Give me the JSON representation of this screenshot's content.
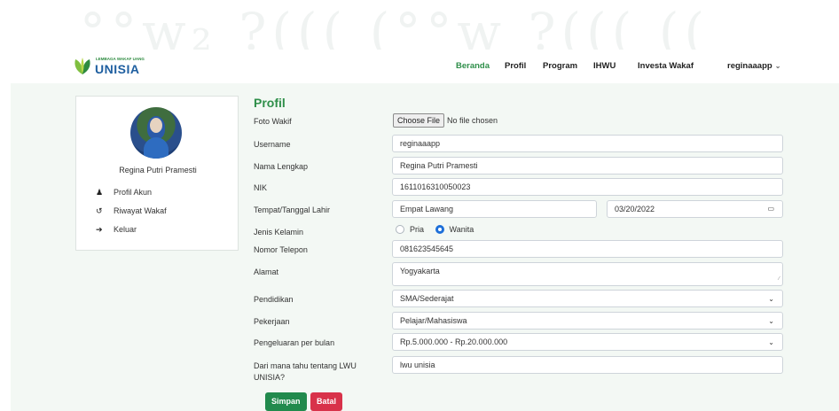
{
  "banner": {
    "decoration_text": "°°w₂ ?((( (°°w ?((( (("
  },
  "brand": {
    "small_text": "LEMBAGA WAKAF UANG",
    "name": "UNISIA",
    "colors": {
      "green": "#2f8f4a",
      "blue": "#1f5fa0"
    }
  },
  "nav": {
    "items": [
      {
        "label": "Beranda",
        "active": true
      },
      {
        "label": "Profil",
        "active": false
      },
      {
        "label": "Program",
        "active": false
      },
      {
        "label": "IHWU",
        "active": false
      },
      {
        "label": "Investa Wakaf",
        "active": false
      }
    ],
    "user": {
      "label": "reginaaapp",
      "icon": "chevron-down-icon"
    }
  },
  "sidebar": {
    "name": "Regina Putri Pramesti",
    "items": [
      {
        "label": "Profil Akun",
        "icon": "user-icon"
      },
      {
        "label": "Riwayat Wakaf",
        "icon": "history-icon"
      },
      {
        "label": "Keluar",
        "icon": "sign-out-icon"
      }
    ]
  },
  "form": {
    "title": "Profil",
    "foto": {
      "label": "Foto Wakif",
      "button": "Choose File",
      "status": "No file chosen"
    },
    "username": {
      "label": "Username",
      "value": "reginaaapp"
    },
    "nama": {
      "label": "Nama Lengkap",
      "value": "Regina Putri Pramesti"
    },
    "nik": {
      "label": "NIK",
      "value": "1611016310050023"
    },
    "ttl": {
      "label": "Tempat/Tanggal Lahir",
      "place": "Empat Lawang",
      "date": "03/20/2022"
    },
    "gender": {
      "label": "Jenis Kelamin",
      "options": [
        "Pria",
        "Wanita"
      ],
      "selected": "Wanita"
    },
    "telepon": {
      "label": "Nomor Telepon",
      "value": "081623545645"
    },
    "alamat": {
      "label": "Alamat",
      "value": "Yogyakarta"
    },
    "pendidikan": {
      "label": "Pendidikan",
      "value": "SMA/Sederajat"
    },
    "pekerjaan": {
      "label": "Pekerjaan",
      "value": "Pelajar/Mahasiswa"
    },
    "pengeluaran": {
      "label": "Pengeluaran per bulan",
      "value": "Rp.5.000.000 - Rp.20.000.000"
    },
    "sumber": {
      "label": "Dari mana tahu tentang LWU UNISIA?",
      "value": "lwu unisia"
    },
    "buttons": {
      "save": "Simpan",
      "cancel": "Batal"
    },
    "colors": {
      "save": "#218a4d",
      "cancel": "#d8324a",
      "radio": "#1e6fd9"
    }
  }
}
